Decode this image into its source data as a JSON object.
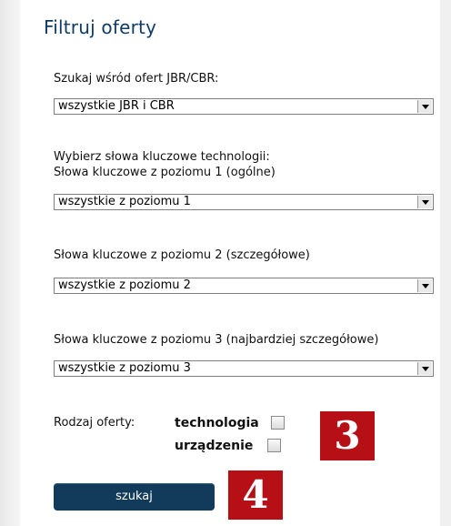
{
  "header": {
    "title": "Filtruj oferty"
  },
  "filters": {
    "offers_label": "Szukaj wśród ofert JBR/CBR:",
    "offers_value": "wszystkie JBR i CBR",
    "keywords_intro": "Wybierz słowa kluczowe technologii:",
    "level1_label": "Słowa kluczowe z poziomu 1 (ogólne)",
    "level1_value": "wszystkie z poziomu 1",
    "level2_label": "Słowa kluczowe z poziomu 2 (szczegółowe)",
    "level2_value": "wszystkie z poziomu 2",
    "level3_label": "Słowa kluczowe z poziomu 3 (najbardziej szczegółowe)",
    "level3_value": "wszystkie z poziomu 3"
  },
  "offer_type": {
    "label": "Rodzaj oferty:",
    "options": [
      {
        "label": "technologia",
        "checked": false
      },
      {
        "label": "urządzenie",
        "checked": false
      }
    ]
  },
  "actions": {
    "search_label": "szukaj"
  },
  "annotations": {
    "badge_3": "3",
    "badge_4": "4",
    "badge_color": "#b70f16"
  },
  "colors": {
    "title": "#0f3c63",
    "button": "#123a5a"
  }
}
